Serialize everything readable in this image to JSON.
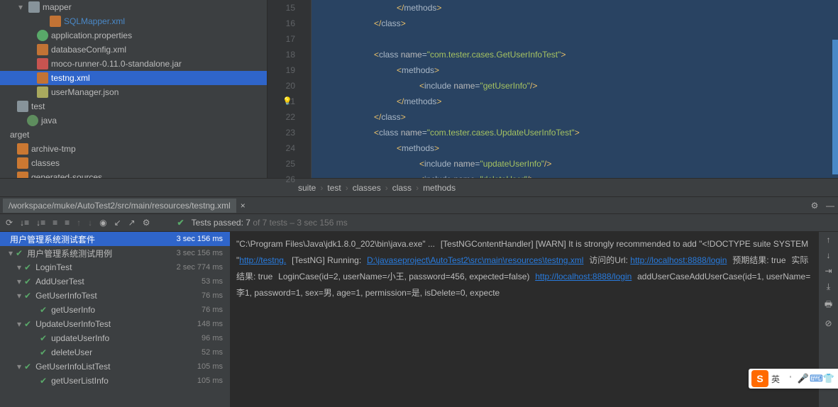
{
  "tree": {
    "items": [
      {
        "indent": 16,
        "chev": "▾",
        "icon": "folder",
        "label": "mapper"
      },
      {
        "indent": 46,
        "chev": "",
        "icon": "xml",
        "label": "SQLMapper.xml",
        "color": "#4a88c7"
      },
      {
        "indent": 28,
        "chev": "",
        "icon": "prop",
        "label": "application.properties"
      },
      {
        "indent": 28,
        "chev": "",
        "icon": "xml",
        "label": "databaseConfig.xml"
      },
      {
        "indent": 28,
        "chev": "",
        "icon": "jar",
        "label": "moco-runner-0.11.0-standalone.jar"
      },
      {
        "indent": 28,
        "chev": "",
        "icon": "xml",
        "label": "testng.xml",
        "selected": true
      },
      {
        "indent": 28,
        "chev": "",
        "icon": "json",
        "label": "userManager.json"
      },
      {
        "indent": 0,
        "chev": "",
        "icon": "folder",
        "label": "test"
      },
      {
        "indent": 14,
        "chev": "",
        "icon": "pkg",
        "label": "java"
      },
      {
        "indent": -10,
        "chev": "",
        "icon": "",
        "label": "arget"
      },
      {
        "indent": 0,
        "chev": "",
        "icon": "gen",
        "label": "archive-tmp"
      },
      {
        "indent": 0,
        "chev": "",
        "icon": "gen",
        "label": "classes"
      },
      {
        "indent": 0,
        "chev": "",
        "icon": "gen",
        "label": "generated-sources"
      }
    ]
  },
  "gutter": {
    "start": 15,
    "end": 26,
    "bulbAt": 21
  },
  "code": {
    "lines": [
      {
        "pad": 106,
        "parts": [
          {
            "t": "</",
            "c": "tag"
          },
          {
            "t": "methods"
          },
          {
            "t": ">",
            "c": "tag"
          }
        ]
      },
      {
        "pad": 74,
        "parts": [
          {
            "t": "</",
            "c": "tag"
          },
          {
            "t": "class"
          },
          {
            "t": ">",
            "c": "tag"
          }
        ]
      },
      {
        "pad": 0,
        "parts": []
      },
      {
        "pad": 74,
        "parts": [
          {
            "t": "<",
            "c": "tag"
          },
          {
            "t": "class "
          },
          {
            "t": "name",
            "c": "attr"
          },
          {
            "t": "="
          },
          {
            "t": "\"com.tester.cases.GetUserInfoTest\"",
            "c": "str"
          },
          {
            "t": ">",
            "c": "tag"
          }
        ]
      },
      {
        "pad": 106,
        "parts": [
          {
            "t": "<",
            "c": "tag"
          },
          {
            "t": "methods"
          },
          {
            "t": ">",
            "c": "tag"
          }
        ]
      },
      {
        "pad": 138,
        "parts": [
          {
            "t": "<",
            "c": "tag"
          },
          {
            "t": "include "
          },
          {
            "t": "name",
            "c": "attr"
          },
          {
            "t": "="
          },
          {
            "t": "\"getUserInfo\"",
            "c": "str"
          },
          {
            "t": "/>",
            "c": "tag"
          }
        ]
      },
      {
        "pad": 106,
        "parts": [
          {
            "t": "</",
            "c": "tag"
          },
          {
            "t": "methods"
          },
          {
            "t": ">",
            "c": "tag"
          }
        ]
      },
      {
        "pad": 74,
        "parts": [
          {
            "t": "</",
            "c": "tag"
          },
          {
            "t": "class"
          },
          {
            "t": ">",
            "c": "tag"
          }
        ]
      },
      {
        "pad": 74,
        "parts": [
          {
            "t": "<",
            "c": "tag"
          },
          {
            "t": "class "
          },
          {
            "t": "name",
            "c": "attr"
          },
          {
            "t": "="
          },
          {
            "t": "\"com.tester.cases.UpdateUserInfoTest\"",
            "c": "str"
          },
          {
            "t": ">",
            "c": "tag"
          }
        ]
      },
      {
        "pad": 106,
        "parts": [
          {
            "t": "<",
            "c": "tag"
          },
          {
            "t": "methods"
          },
          {
            "t": ">",
            "c": "tag"
          }
        ]
      },
      {
        "pad": 138,
        "parts": [
          {
            "t": "<",
            "c": "tag"
          },
          {
            "t": "include "
          },
          {
            "t": "name",
            "c": "attr"
          },
          {
            "t": "="
          },
          {
            "t": "\"updateUserInfo\"",
            "c": "str"
          },
          {
            "t": "/>",
            "c": "tag"
          }
        ]
      },
      {
        "pad": 138,
        "parts": [
          {
            "t": "<",
            "c": "tag"
          },
          {
            "t": "include "
          },
          {
            "t": "name",
            "c": "attr"
          },
          {
            "t": "="
          },
          {
            "t": "\"deleteUser\"",
            "c": "str"
          },
          {
            "t": "/>",
            "c": "tag"
          }
        ]
      }
    ]
  },
  "breadcrumb": [
    "suite",
    "test",
    "classes",
    "class",
    "methods"
  ],
  "panel": {
    "tab": "/workspace/muke/AutoTest2/src/main/resources/testng.xml"
  },
  "runbar": {
    "passed_label": "Tests passed:",
    "passed_n": "7",
    "of": "of 7 tests",
    "time": "– 3 sec 156 ms"
  },
  "tests": {
    "header": {
      "name": "用户管理系统测试套件",
      "time": "3 sec 156 ms"
    },
    "rows": [
      {
        "chev": "▾",
        "pad": 8,
        "name": "用户管理系统测试用例",
        "time": "3 sec 156 ms"
      },
      {
        "chev": "▾",
        "pad": 20,
        "name": "LoginTest",
        "time": "2 sec 774 ms"
      },
      {
        "chev": "▾",
        "pad": 20,
        "name": "AddUserTest",
        "time": "53 ms"
      },
      {
        "chev": "▾",
        "pad": 20,
        "name": "GetUserInfoTest",
        "time": "76 ms"
      },
      {
        "chev": "",
        "pad": 42,
        "name": "getUserInfo",
        "time": "76 ms"
      },
      {
        "chev": "▾",
        "pad": 20,
        "name": "UpdateUserInfoTest",
        "time": "148 ms"
      },
      {
        "chev": "",
        "pad": 42,
        "name": "updateUserInfo",
        "time": "96 ms"
      },
      {
        "chev": "",
        "pad": 42,
        "name": "deleteUser",
        "time": "52 ms"
      },
      {
        "chev": "▾",
        "pad": 20,
        "name": "GetUserInfoListTest",
        "time": "105 ms"
      },
      {
        "chev": "",
        "pad": 42,
        "name": "getUserListInfo",
        "time": "105 ms"
      }
    ]
  },
  "console": {
    "l1": "\"C:\\Program Files\\Java\\jdk1.8.0_202\\bin\\java.exe\" ...",
    "l2a": "[TestNGContentHandler] [WARN] It is strongly recommended to add \"<!DOCTYPE suite SYSTEM \"",
    "l2b": "http://testng.",
    "l3": "[TestNG] Running:",
    "l4": "  D:\\javaseproject\\AutoTest2\\src\\main\\resources\\testng.xml",
    "l6a": "访问的Url: ",
    "l6b": "http://localhost:8888/login",
    "l7": "预期结果: true",
    "l8": "实际结果: true",
    "l9": "LoginCase(id=2, userName=小王, password=456, expected=false)",
    "l10": "http://localhost:8888/login",
    "l11": "addUserCaseAddUserCase(id=1, userName=李1, password=1, sex=男, age=1, permission=是, isDelete=0, expecte"
  },
  "ime": {
    "label": "英"
  }
}
